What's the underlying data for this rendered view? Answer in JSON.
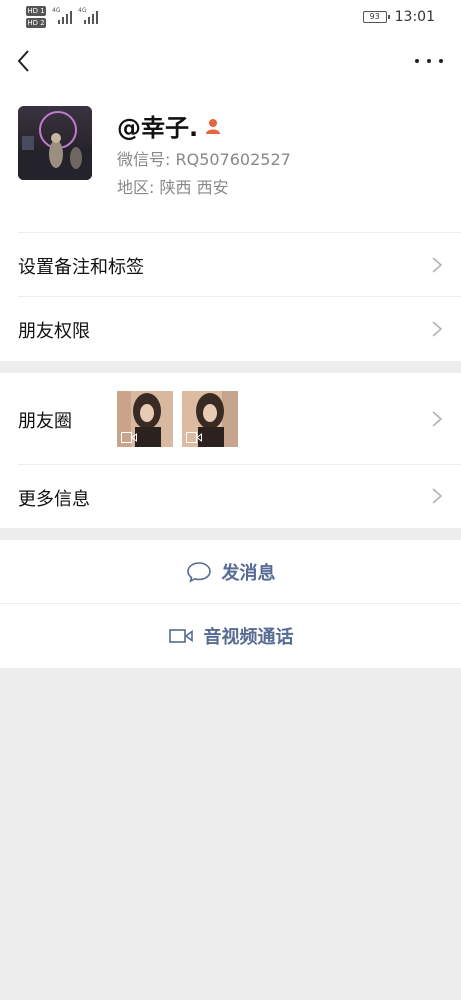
{
  "status_bar": {
    "hd1": "HD 1",
    "hd2": "HD 2",
    "signal1_tech": "4G",
    "signal2_tech": "4G",
    "battery": "93",
    "time": "13:01"
  },
  "nav": {
    "back_icon": "chevron-left-icon",
    "more_icon": "more-dots-icon"
  },
  "profile": {
    "name": "@幸子.",
    "wechat_id": "微信号: RQ507602527",
    "region": "地区: 陕西  西安"
  },
  "rows": {
    "remark_tags": "设置备注和标签",
    "friend_permissions": "朋友权限",
    "moments": "朋友圈",
    "more_info": "更多信息"
  },
  "actions": {
    "send_message": "发消息",
    "video_call": "音视频通话"
  },
  "colors": {
    "action_text": "#576b95",
    "background": "#ededed",
    "person_icon": "#e8643c"
  }
}
